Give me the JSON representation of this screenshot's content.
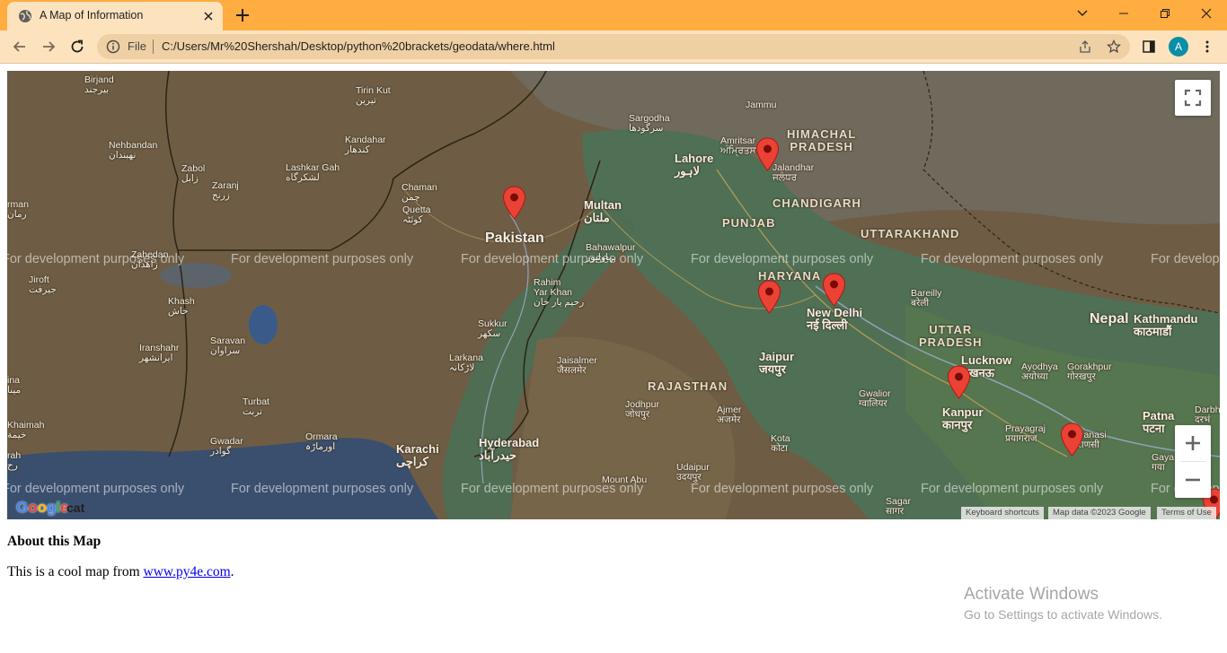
{
  "browser": {
    "tab_title": "A Map of Information",
    "scheme": "File",
    "url": "C:/Users/Mr%20Shershah/Desktop/python%20brackets/geodata/where.html",
    "profile_initial": "A",
    "accent_color": "#ffac40"
  },
  "map": {
    "dev_watermark": "For development purposes only",
    "logo_text": "Google",
    "logo_suffix": "cat",
    "attribution": {
      "keyboard": "Keyboard shortcuts",
      "data": "Map data ©2023 Google",
      "terms": "Terms of Use"
    },
    "marker_color": "#ea4335",
    "places": [
      {
        "id": "birjand",
        "text": "Birjand\nبیرجند"
      },
      {
        "id": "tirinkut",
        "text": "Tirin Kut\nتیرین"
      },
      {
        "id": "nehbandan",
        "text": "Nehbandan\nنهبندان"
      },
      {
        "id": "kandahar",
        "text": "Kandahar\nکندهار"
      },
      {
        "id": "sargodha",
        "text": "Sargodha\nسرگودھا"
      },
      {
        "id": "jammu",
        "text": "Jammu"
      },
      {
        "id": "himachal",
        "text": "HIMACHAL\nPRADESH"
      },
      {
        "id": "zabol",
        "text": "Zabol\nزابل"
      },
      {
        "id": "zaranj",
        "text": "Zaranj\nزرنج"
      },
      {
        "id": "lashkargah",
        "text": "Lashkar Gah\nلشکرگاه"
      },
      {
        "id": "amritsar",
        "text": "Amritsar\nਅੰਮ੍ਰਿਤਸਰ"
      },
      {
        "id": "lahore",
        "text": "Lahore\nلاہور"
      },
      {
        "id": "jalandhar",
        "text": "Jalandhar\nਜਲੰਧਰ"
      },
      {
        "id": "chaman",
        "text": "Chaman\nچمن"
      },
      {
        "id": "quetta",
        "text": "Quetta\nکوئٹہ"
      },
      {
        "id": "multan",
        "text": "Multan\nملتان"
      },
      {
        "id": "punjab",
        "text": "PUNJAB"
      },
      {
        "id": "chandigarh",
        "text": "CHANDIGARH"
      },
      {
        "id": "uttarakhand",
        "text": "UTTARAKHAND"
      },
      {
        "id": "pakistan",
        "text": "Pakistan"
      },
      {
        "id": "bahawalpur",
        "text": "Bahawalpur\nبہاولپور"
      },
      {
        "id": "zahedan",
        "text": "Zahedan\nزاهدان"
      },
      {
        "id": "rmania",
        "text": "rman\nرمان"
      },
      {
        "id": "jiroft",
        "text": "Jiroft\nجیرفت"
      },
      {
        "id": "rahim",
        "text": "Rahim\nYar Khan\nرحیم یار خان"
      },
      {
        "id": "haryana",
        "text": "HARYANA"
      },
      {
        "id": "newdelhi",
        "text": "New Delhi\nनई दिल्ली"
      },
      {
        "id": "bareilly",
        "text": "Bareilly\nबरेली"
      },
      {
        "id": "nepal",
        "text": "Nepal"
      },
      {
        "id": "kathmandu",
        "text": "Kathmandu\nकाठमाडौं"
      },
      {
        "id": "khash",
        "text": "Khash\nخاش"
      },
      {
        "id": "sukkur",
        "text": "Sukkur\nسکھر"
      },
      {
        "id": "uttarpradesh",
        "text": "UTTAR\nPRADESH"
      },
      {
        "id": "saravan",
        "text": "Saravan\nسراوان"
      },
      {
        "id": "iranshahr",
        "text": "Iranshahr\nایرانشهر"
      },
      {
        "id": "jaipur",
        "text": "Jaipur\nजयपुर"
      },
      {
        "id": "lucknow",
        "text": "Lucknow\nलखनऊ"
      },
      {
        "id": "ayodhya",
        "text": "Ayodhya\nअयोध्या"
      },
      {
        "id": "gorakhpur",
        "text": "Gorakhpur\nगोरखपुर"
      },
      {
        "id": "larkana",
        "text": "Larkana\nلاڑکانہ"
      },
      {
        "id": "jaisalmer",
        "text": "Jaisalmer\nजैसलमेर"
      },
      {
        "id": "rajasthan",
        "text": "RAJASTHAN"
      },
      {
        "id": "gwalior",
        "text": "Gwalior\nग्वालियर"
      },
      {
        "id": "mina",
        "text": "ina\nمینا"
      },
      {
        "id": "turbat",
        "text": "Turbat\nتربت"
      },
      {
        "id": "jodhpur",
        "text": "Jodhpur\nजोधपुर"
      },
      {
        "id": "ajmer",
        "text": "Ajmer\nअजमेर"
      },
      {
        "id": "kanpur",
        "text": "Kanpur\nकानपुर"
      },
      {
        "id": "prayagraj",
        "text": "Prayagraj\nप्रयागराज"
      },
      {
        "id": "patna",
        "text": "Patna\nपटना"
      },
      {
        "id": "darbh",
        "text": "Darbh\nदरभं"
      },
      {
        "id": "khaimah",
        "text": "Khaimah\nخيمة"
      },
      {
        "id": "ormara",
        "text": "Ormara\nاورماڑہ"
      },
      {
        "id": "gwadar",
        "text": "Gwadar\nگوادر"
      },
      {
        "id": "karachi",
        "text": "Karachi\nکراچی"
      },
      {
        "id": "hyderabad",
        "text": "Hyderabad\nحیدرآباد"
      },
      {
        "id": "kota",
        "text": "Kota\nकोटा"
      },
      {
        "id": "varanasi",
        "text": "Varanasi\nवाराणसी"
      },
      {
        "id": "gaya",
        "text": "Gaya\nगया"
      },
      {
        "id": "rah",
        "text": "rah\nرح"
      },
      {
        "id": "mountabu",
        "text": "Mount Abu"
      },
      {
        "id": "udaipur",
        "text": "Udaipur\nउदयपुर"
      },
      {
        "id": "sagar",
        "text": "Sagar\nसागर"
      }
    ]
  },
  "content": {
    "heading": "About this Map",
    "text_before": "This is a cool map from ",
    "link_text": "www.py4e.com",
    "text_after": "."
  },
  "os": {
    "activate_title": "Activate Windows",
    "activate_sub": "Go to Settings to activate Windows."
  }
}
